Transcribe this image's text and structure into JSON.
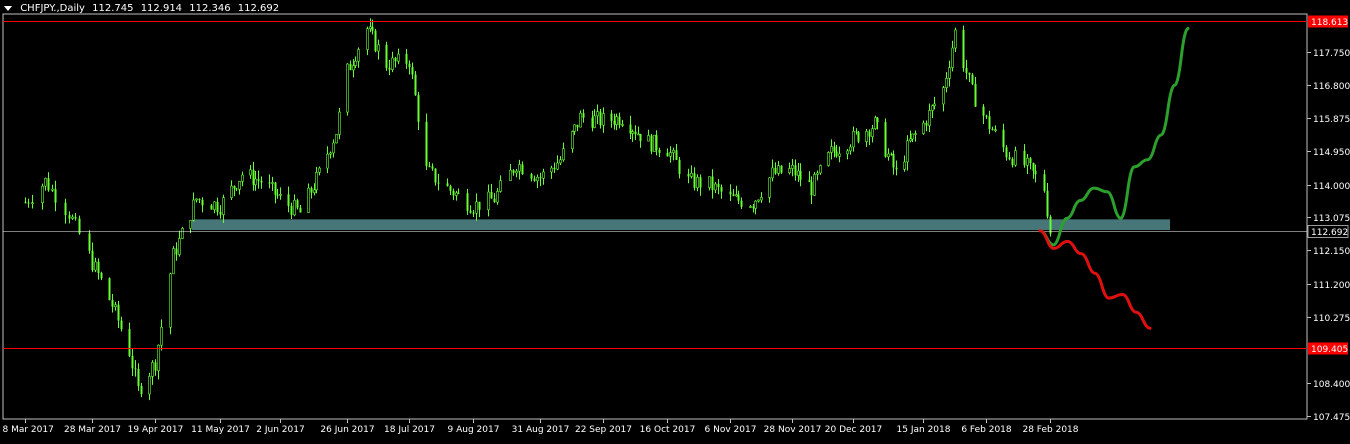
{
  "header": {
    "symbol": "CHFJPY.,Daily",
    "open": "112.745",
    "high": "112.914",
    "low": "112.346",
    "close": "112.692"
  },
  "colors": {
    "background": "#000000",
    "bull_candle": "#66ff33",
    "level_line": "#ff0000",
    "support_zone": "#5f9ea0",
    "bull_projection": "#2ca02c",
    "bear_projection": "#e01010"
  },
  "chart_data": {
    "type": "candlestick",
    "symbol": "CHFJPY",
    "timeframe": "Daily",
    "ylim": [
      107.0,
      119.0
    ],
    "y_ticks": [
      "118.613",
      "117.750",
      "116.800",
      "115.875",
      "114.950",
      "114.000",
      "113.075",
      "112.692",
      "112.150",
      "111.200",
      "110.275",
      "109.405",
      "108.400",
      "107.475"
    ],
    "x_ticks": [
      "8 Mar 2017",
      "28 Mar 2017",
      "19 Apr 2017",
      "11 May 2017",
      "2 Jun 2017",
      "26 Jun 2017",
      "18 Jul 2017",
      "9 Aug 2017",
      "31 Aug 2017",
      "22 Sep 2017",
      "16 Oct 2017",
      "6 Nov 2017",
      "28 Nov 2017",
      "20 Dec 2017",
      "15 Jan 2018",
      "6 Feb 2018",
      "28 Feb 2018"
    ],
    "price_path": [
      [
        "8 Mar 2017",
        113.5
      ],
      [
        "14 Mar 2017",
        114.1
      ],
      [
        "21 Mar 2017",
        113.2
      ],
      [
        "28 Mar 2017",
        111.8
      ],
      [
        "4 Apr 2017",
        110.6
      ],
      [
        "10 Apr 2017",
        109.3
      ],
      [
        "13 Apr 2017",
        108.2
      ],
      [
        "19 Apr 2017",
        109.0
      ],
      [
        "25 Apr 2017",
        112.0
      ],
      [
        "3 May 2017",
        113.6
      ],
      [
        "11 May 2017",
        113.4
      ],
      [
        "19 May 2017",
        114.3
      ],
      [
        "26 May 2017",
        114.1
      ],
      [
        "2 Jun 2017",
        113.6
      ],
      [
        "9 Jun 2017",
        113.2
      ],
      [
        "16 Jun 2017",
        114.3
      ],
      [
        "22 Jun 2017",
        115.5
      ],
      [
        "26 Jun 2017",
        117.2
      ],
      [
        "3 Jul 2017",
        118.4
      ],
      [
        "10 Jul 2017",
        117.4
      ],
      [
        "18 Jul 2017",
        117.5
      ],
      [
        "24 Jul 2017",
        114.4
      ],
      [
        "31 Jul 2017",
        113.9
      ],
      [
        "9 Aug 2017",
        113.4
      ],
      [
        "16 Aug 2017",
        113.6
      ],
      [
        "23 Aug 2017",
        114.6
      ],
      [
        "31 Aug 2017",
        114.2
      ],
      [
        "7 Sep 2017",
        114.7
      ],
      [
        "14 Sep 2017",
        115.9
      ],
      [
        "22 Sep 2017",
        115.8
      ],
      [
        "29 Sep 2017",
        115.9
      ],
      [
        "9 Oct 2017",
        115.2
      ],
      [
        "16 Oct 2017",
        115.0
      ],
      [
        "23 Oct 2017",
        114.1
      ],
      [
        "30 Oct 2017",
        114.0
      ],
      [
        "6 Nov 2017",
        113.6
      ],
      [
        "14 Nov 2017",
        113.5
      ],
      [
        "21 Nov 2017",
        114.3
      ],
      [
        "28 Nov 2017",
        114.4
      ],
      [
        "5 Dec 2017",
        113.9
      ],
      [
        "12 Dec 2017",
        114.9
      ],
      [
        "20 Dec 2017",
        115.3
      ],
      [
        "28 Dec 2017",
        115.7
      ],
      [
        "5 Jan 2018",
        114.3
      ],
      [
        "10 Jan 2018",
        115.2
      ],
      [
        "15 Jan 2018",
        115.7
      ],
      [
        "22 Jan 2018",
        116.7
      ],
      [
        "26 Jan 2018",
        118.3
      ],
      [
        "1 Feb 2018",
        116.6
      ],
      [
        "6 Feb 2018",
        115.8
      ],
      [
        "13 Feb 2018",
        114.9
      ],
      [
        "20 Feb 2018",
        114.5
      ],
      [
        "26 Feb 2018",
        113.9
      ],
      [
        "28 Feb 2018",
        112.69
      ]
    ],
    "levels": [
      {
        "price": 118.613,
        "label": "118.613",
        "color": "#ff0000"
      },
      {
        "price": 109.405,
        "label": "109.405",
        "color": "#ff0000"
      },
      {
        "price": 112.692,
        "label": "112.692",
        "color": "#ffffff"
      }
    ],
    "support_zone": {
      "from": 112.72,
      "to": 113.02,
      "start": "11 May 2017"
    },
    "projections": [
      {
        "direction": "bullish",
        "color": "#2ca02c",
        "path": [
          112.7,
          112.3,
          113.05,
          113.55,
          113.9,
          113.8,
          113.05,
          114.5,
          114.7,
          115.4,
          116.8,
          118.4
        ]
      },
      {
        "direction": "bearish",
        "color": "#e01010",
        "path": [
          112.7,
          112.2,
          112.4,
          112.05,
          111.5,
          110.8,
          110.9,
          110.4,
          109.95
        ]
      }
    ],
    "grid": false,
    "legend": "none"
  }
}
